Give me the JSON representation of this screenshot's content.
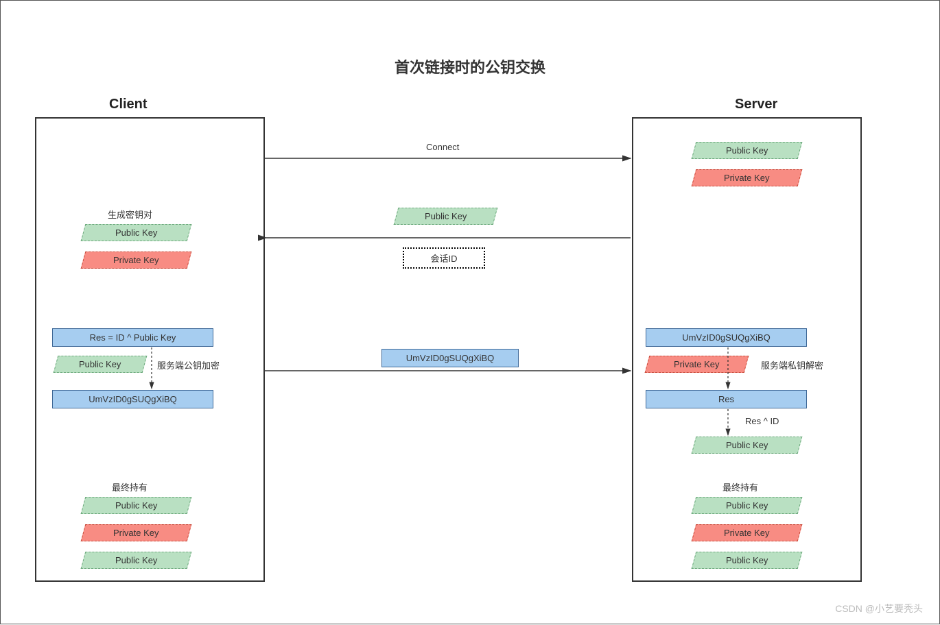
{
  "title": "首次链接时的公钥交换",
  "client_label": "Client",
  "server_label": "Server",
  "labels": {
    "connect": "Connect",
    "gen_keypair": "生成密钥对",
    "public_key": "Public Key",
    "private_key": "Private Key",
    "session_id": "会话ID",
    "res_formula": "Res = ID ^ Public Key",
    "enc_server_pub": "服务端公钥加密",
    "cipher_text": "UmVzID0gSUQgXiBQ",
    "dec_server_priv": "服务端私钥解密",
    "res": "Res",
    "res_xor_id": "Res ^ ID",
    "final_holds": "最终持有"
  },
  "colors": {
    "green_bg": "#b9e0c2",
    "red_bg": "#f88c83",
    "blue_bg": "#a6cdf0"
  },
  "footer": "CSDN @小艺要秃头"
}
